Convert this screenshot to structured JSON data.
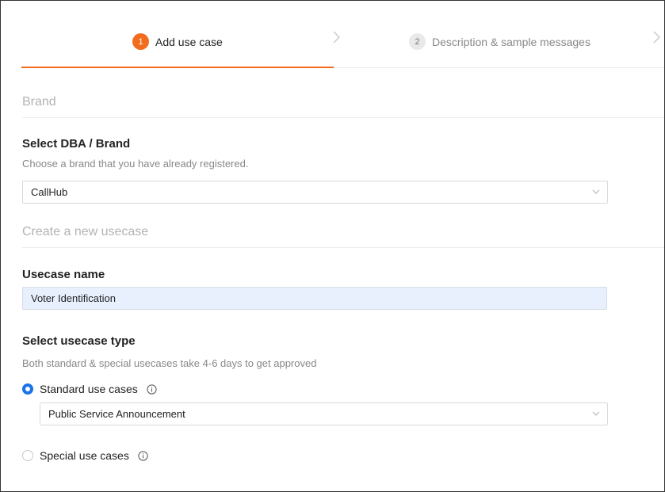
{
  "stepper": {
    "steps": [
      {
        "number": "1",
        "label": "Add use case",
        "active": true
      },
      {
        "number": "2",
        "label": "Description & sample messages",
        "active": false
      }
    ]
  },
  "brand_section": {
    "heading": "Brand",
    "field_label": "Select DBA / Brand",
    "help_text": "Choose a brand that you have already registered.",
    "selected_value": "CallHub"
  },
  "usecase_section": {
    "heading": "Create a new usecase",
    "name_label": "Usecase name",
    "name_value": "Voter Identification",
    "type_label": "Select usecase type",
    "type_help_text": "Both standard & special usecases take 4-6 days to get approved",
    "standard_label": "Standard use cases",
    "standard_selected_value": "Public Service Announcement",
    "special_label": "Special use cases"
  },
  "colors": {
    "accent": "#f26c1f",
    "radio_selected": "#1a73e8",
    "autofill_bg": "#e8f0fe"
  },
  "icons": {
    "step_separator": "chevron-right-icon",
    "select_arrow": "chevron-down-icon",
    "info": "info-circle-icon"
  }
}
